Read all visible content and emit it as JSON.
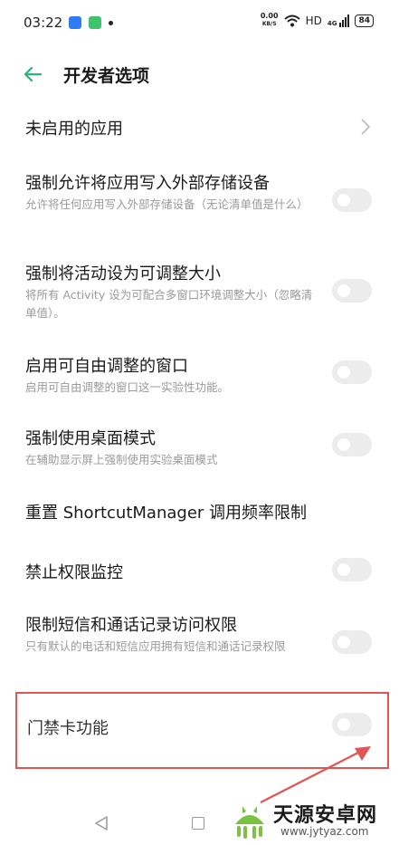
{
  "status_bar": {
    "time": "03:22",
    "net_speed_value": "0.00",
    "net_speed_unit": "KB/S",
    "hd_label": "HD",
    "signal_label": "4G",
    "battery_level": "84"
  },
  "header": {
    "title": "开发者选项"
  },
  "settings": [
    {
      "title": "未启用的应用",
      "subtitle": "",
      "control": "chevron"
    },
    {
      "title": "强制允许将应用写入外部存储设备",
      "subtitle": "允许将任何应用写入外部存储设备（无论清单值是什么）",
      "control": "toggle"
    },
    {
      "title": "强制将活动设为可调整大小",
      "subtitle": "将所有 Activity 设为可配合多窗口环境调整大小（忽略清单值）。",
      "control": "toggle"
    },
    {
      "title": "启用可自由调整的窗口",
      "subtitle": "启用可自由调整的窗口这一实验性功能。",
      "control": "toggle"
    },
    {
      "title": "强制使用桌面模式",
      "subtitle": "在辅助显示屏上强制使用实验桌面模式",
      "control": "toggle"
    },
    {
      "title": "重置 ShortcutManager 调用频率限制",
      "subtitle": "",
      "control": "none"
    },
    {
      "title": "禁止权限监控",
      "subtitle": "",
      "control": "toggle"
    },
    {
      "title": "限制短信和通话记录访问权限",
      "subtitle": "只有默认的电话和短信应用拥有短信和通话记录权限",
      "control": "toggle"
    },
    {
      "title": "门禁卡功能",
      "subtitle": "",
      "control": "toggle"
    }
  ],
  "watermark": {
    "title": "天源安卓网",
    "url": "www.jytyaz.com"
  },
  "colors": {
    "accent": "#2db37a",
    "toggle_off": "#ececec",
    "highlight": "#e05555"
  }
}
